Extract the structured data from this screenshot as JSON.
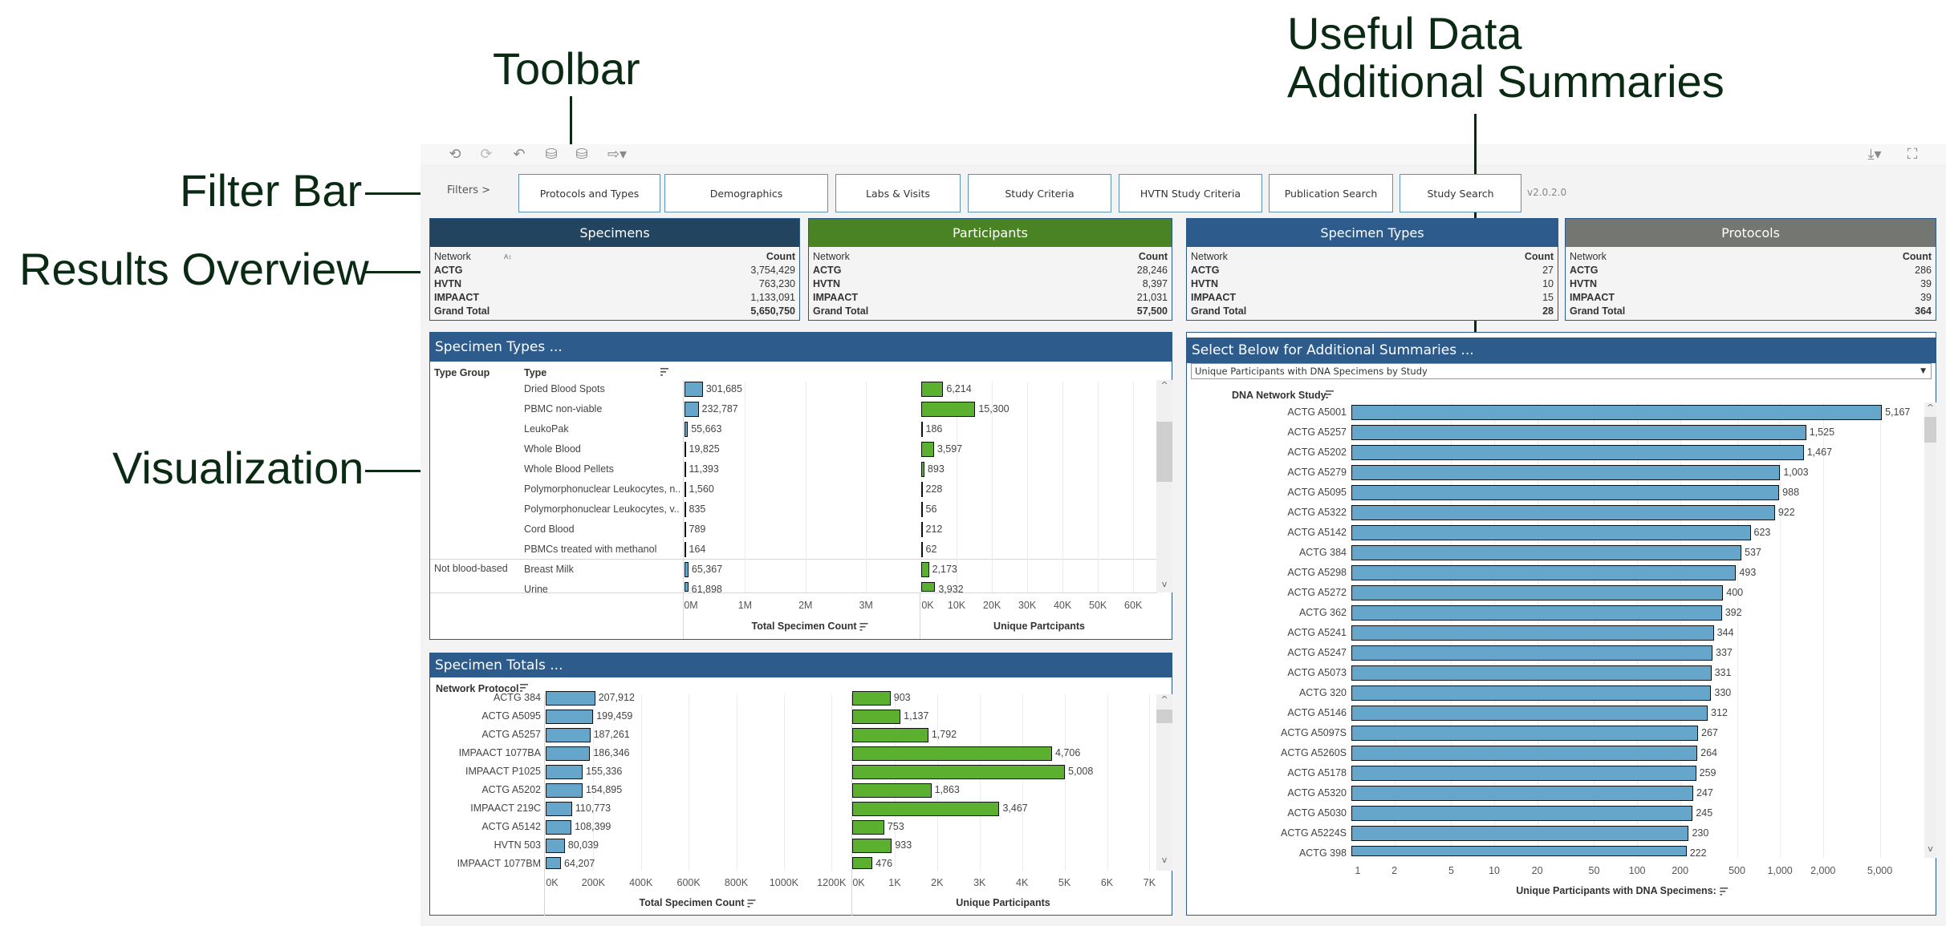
{
  "annotations": {
    "toolbar": "Toolbar",
    "filter_bar": "Filter Bar",
    "results_overview": "Results Overview",
    "visualization": "Visualization",
    "useful_data_line1": "Useful Data",
    "useful_data_line2": "Additional Summaries"
  },
  "toolbar": {
    "icons": [
      "undo-icon",
      "redo-icon",
      "revert-icon",
      "refresh-data-icon",
      "pause-updates-icon",
      "share-icon"
    ],
    "right_icons": [
      "download-icon",
      "fullscreen-icon"
    ]
  },
  "filter_bar": {
    "label": "Filters >",
    "buttons": [
      {
        "label": "Protocols and Types"
      },
      {
        "label": "Demographics"
      },
      {
        "label": "Labs & Visits"
      },
      {
        "label": "Study Criteria"
      },
      {
        "label": "HVTN Study Criteria"
      },
      {
        "label": "Publication Search"
      },
      {
        "label": "Study Search"
      }
    ],
    "version": "v2.0.2.0"
  },
  "kpis": [
    {
      "title": "Specimens",
      "color": "#23445e",
      "col1": "Network",
      "col2": "Count",
      "rows": [
        {
          "k": "ACTG",
          "v": "3,754,429"
        },
        {
          "k": "HVTN",
          "v": "763,230"
        },
        {
          "k": "IMPAACT",
          "v": "1,133,091"
        }
      ],
      "total_label": "Grand Total",
      "total": "5,650,750"
    },
    {
      "title": "Participants",
      "color": "#4a8324",
      "col1": "Network",
      "col2": "Count",
      "rows": [
        {
          "k": "ACTG",
          "v": "28,246"
        },
        {
          "k": "HVTN",
          "v": "8,397"
        },
        {
          "k": "IMPAACT",
          "v": "21,031"
        }
      ],
      "total_label": "Grand Total",
      "total": "57,500"
    },
    {
      "title": "Specimen Types",
      "color": "#2d5c8c",
      "col1": "Network",
      "col2": "Count",
      "rows": [
        {
          "k": "ACTG",
          "v": "27"
        },
        {
          "k": "HVTN",
          "v": "10"
        },
        {
          "k": "IMPAACT",
          "v": "15"
        }
      ],
      "total_label": "Grand Total",
      "total": "28"
    },
    {
      "title": "Protocols",
      "color": "#747672",
      "col1": "Network",
      "col2": "Count",
      "rows": [
        {
          "k": "ACTG",
          "v": "286"
        },
        {
          "k": "HVTN",
          "v": "39"
        },
        {
          "k": "IMPAACT",
          "v": "39"
        }
      ],
      "total_label": "Grand Total",
      "total": "364"
    }
  ],
  "specimen_types_panel": {
    "title": "Specimen Types ...",
    "col_type_group": "Type Group",
    "col_type": "Type",
    "groups": [
      {
        "name": "",
        "first_index": 0
      },
      {
        "name": "Not blood-based",
        "first_index": 9
      }
    ]
  },
  "specimen_totals_panel": {
    "title": "Specimen Totals ...",
    "col_label": "Network Protocol"
  },
  "additional_panel": {
    "title": "Select Below for Additional Summaries ...",
    "dropdown_value": "Unique Participants with DNA Specimens by Study",
    "col_label": "DNA Network Study"
  },
  "chart_data": [
    {
      "type": "bar",
      "title": "Specimen Types ... (Total Specimen Count)",
      "categories": [
        "Dried Blood Spots",
        "PBMC non-viable",
        "LeukoPak",
        "Whole Blood",
        "Whole Blood Pellets",
        "Polymorphonuclear Leukocytes, n..",
        "Polymorphonuclear Leukocytes, v..",
        "Cord Blood",
        "PBMCs treated with methanol",
        "Breast Milk",
        "Urine"
      ],
      "values": [
        301685,
        232787,
        55663,
        19825,
        11393,
        1560,
        835,
        789,
        164,
        65367,
        61898
      ],
      "value_labels": [
        "301,685",
        "232,787",
        "55,663",
        "19,825",
        "11,393",
        "1,560",
        "835",
        "789",
        "164",
        "65,367",
        "61,898"
      ],
      "xlabel": "Total Specimen Count",
      "xlim": [
        0,
        3900000
      ],
      "ticks": [
        0,
        1000000,
        2000000,
        3000000
      ],
      "tick_labels": [
        "0M",
        "1M",
        "2M",
        "3M"
      ],
      "orientation": "horizontal",
      "grid": true
    },
    {
      "type": "bar",
      "title": "Specimen Types ... (Unique Partcipants)",
      "categories": [
        "Dried Blood Spots",
        "PBMC non-viable",
        "LeukoPak",
        "Whole Blood",
        "Whole Blood Pellets",
        "Polymorphonuclear Leukocytes, n..",
        "Polymorphonuclear Leukocytes, v..",
        "Cord Blood",
        "PBMCs treated with methanol",
        "Breast Milk",
        "Urine"
      ],
      "values": [
        6214,
        15300,
        186,
        3597,
        893,
        228,
        56,
        212,
        62,
        2173,
        3932
      ],
      "value_labels": [
        "6,214",
        "15,300",
        "186",
        "3,597",
        "893",
        "228",
        "56",
        "212",
        "62",
        "2,173",
        "3,932"
      ],
      "xlabel": "Unique Partcipants",
      "xlim": [
        0,
        67000
      ],
      "ticks": [
        0,
        10000,
        20000,
        30000,
        40000,
        50000,
        60000
      ],
      "tick_labels": [
        "0K",
        "10K",
        "20K",
        "30K",
        "40K",
        "50K",
        "60K"
      ],
      "orientation": "horizontal",
      "grid": true
    },
    {
      "type": "bar",
      "title": "Specimen Totals ... (Total Specimen Count)",
      "categories": [
        "ACTG 384",
        "ACTG A5095",
        "ACTG A5257",
        "IMPAACT 1077BA",
        "IMPAACT P1025",
        "ACTG A5202",
        "IMPAACT 219C",
        "ACTG A5142",
        "HVTN 503",
        "IMPAACT 1077BM"
      ],
      "values": [
        207912,
        199459,
        187261,
        186346,
        155336,
        154895,
        110773,
        108399,
        80039,
        64207
      ],
      "value_labels": [
        "207,912",
        "199,459",
        "187,261",
        "186,346",
        "155,336",
        "154,895",
        "110,773",
        "108,399",
        "80,039",
        "64,207"
      ],
      "xlabel": "Total Specimen Count",
      "xlim": [
        0,
        1280000
      ],
      "ticks": [
        0,
        200000,
        400000,
        600000,
        800000,
        1000000,
        1200000
      ],
      "tick_labels": [
        "0K",
        "200K",
        "400K",
        "600K",
        "800K",
        "1000K",
        "1200K"
      ],
      "orientation": "horizontal",
      "grid": true
    },
    {
      "type": "bar",
      "title": "Specimen Totals ... (Unique Participants)",
      "categories": [
        "ACTG 384",
        "ACTG A5095",
        "ACTG A5257",
        "IMPAACT 1077BA",
        "IMPAACT P1025",
        "ACTG A5202",
        "IMPAACT 219C",
        "ACTG A5142",
        "HVTN 503",
        "IMPAACT 1077BM"
      ],
      "values": [
        903,
        1137,
        1792,
        4706,
        5008,
        1863,
        3467,
        753,
        933,
        476
      ],
      "value_labels": [
        "903",
        "1,137",
        "1,792",
        "4,706",
        "5,008",
        "1,863",
        "3,467",
        "753",
        "933",
        "476"
      ],
      "xlabel": "Unique Participants",
      "xlim": [
        0,
        7200
      ],
      "ticks": [
        0,
        1000,
        2000,
        3000,
        4000,
        5000,
        6000,
        7000
      ],
      "tick_labels": [
        "0K",
        "1K",
        "2K",
        "3K",
        "4K",
        "5K",
        "6K",
        "7K"
      ],
      "orientation": "horizontal",
      "grid": true
    },
    {
      "type": "bar",
      "title": "Unique Participants with DNA Specimens by Study",
      "categories": [
        "ACTG A5001",
        "ACTG A5257",
        "ACTG A5202",
        "ACTG A5279",
        "ACTG A5095",
        "ACTG A5322",
        "ACTG A5142",
        "ACTG 384",
        "ACTG A5298",
        "ACTG A5272",
        "ACTG 362",
        "ACTG A5241",
        "ACTG A5247",
        "ACTG A5073",
        "ACTG 320",
        "ACTG A5146",
        "ACTG A5097S",
        "ACTG A5260S",
        "ACTG A5178",
        "ACTG A5320",
        "ACTG A5030",
        "ACTG A5224S",
        "ACTG 398"
      ],
      "values": [
        5167,
        1525,
        1467,
        1003,
        988,
        922,
        623,
        537,
        493,
        400,
        392,
        344,
        337,
        331,
        330,
        312,
        267,
        264,
        259,
        247,
        245,
        230,
        222
      ],
      "value_labels": [
        "5,167",
        "1,525",
        "1,467",
        "1,003",
        "988",
        "922",
        "623",
        "537",
        "493",
        "400",
        "392",
        "344",
        "337",
        "331",
        "330",
        "312",
        "267",
        "264",
        "259",
        "247",
        "245",
        "230",
        "222"
      ],
      "xlabel": "Unique Participants with DNA Specimens:",
      "xscale": "log",
      "xlim": [
        1,
        9000
      ],
      "ticks": [
        1,
        2,
        5,
        10,
        20,
        50,
        100,
        200,
        500,
        1000,
        2000,
        5000
      ],
      "tick_labels": [
        "1",
        "2",
        "5",
        "10",
        "20",
        "50",
        "100",
        "200",
        "500",
        "1,000",
        "2,000",
        "5,000"
      ],
      "orientation": "horizontal",
      "grid": true
    }
  ]
}
